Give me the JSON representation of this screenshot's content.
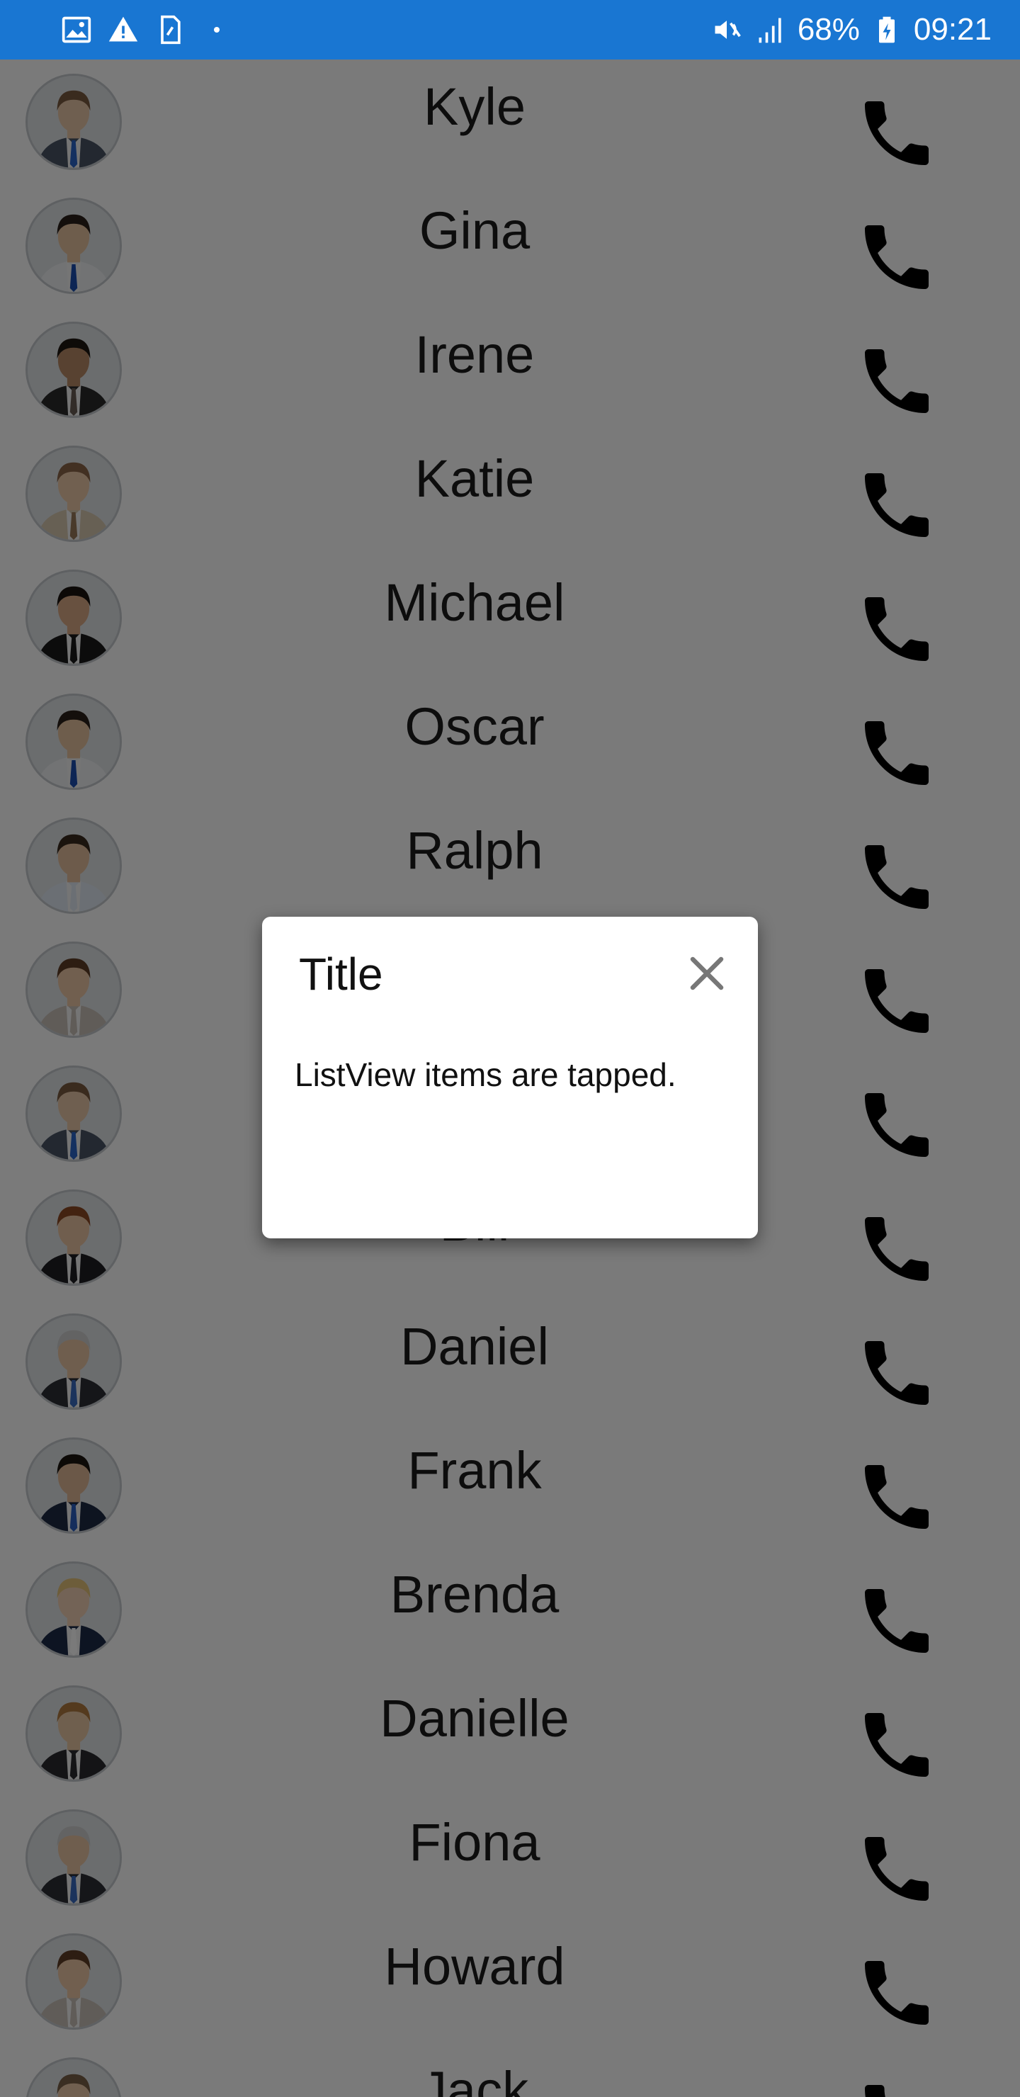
{
  "status_bar": {
    "battery": "68%",
    "time": "09:21",
    "left_icons": [
      "image-icon",
      "warning-icon",
      "sim-icon"
    ],
    "right_icons": [
      "mute-icon",
      "signal-icon",
      "battery-charging-icon"
    ]
  },
  "contacts": [
    {
      "name": "Kyle",
      "avatar": "person-male-1"
    },
    {
      "name": "Gina",
      "avatar": "person-male-2"
    },
    {
      "name": "Irene",
      "avatar": "person-male-3"
    },
    {
      "name": "Katie",
      "avatar": "person-male-4"
    },
    {
      "name": "Michael",
      "avatar": "person-male-5"
    },
    {
      "name": "Oscar",
      "avatar": "person-male-2"
    },
    {
      "name": "Ralph",
      "avatar": "person-male-6"
    },
    {
      "name": "",
      "avatar": "person-female-1"
    },
    {
      "name": "",
      "avatar": "person-male-1"
    },
    {
      "name": "Bill",
      "avatar": "person-female-2"
    },
    {
      "name": "Daniel",
      "avatar": "person-male-7"
    },
    {
      "name": "Frank",
      "avatar": "person-male-8"
    },
    {
      "name": "Brenda",
      "avatar": "person-female-3"
    },
    {
      "name": "Danielle",
      "avatar": "person-male-9"
    },
    {
      "name": "Fiona",
      "avatar": "person-male-7"
    },
    {
      "name": "Howard",
      "avatar": "person-female-1"
    },
    {
      "name": "Jack",
      "avatar": "person-female-4"
    }
  ],
  "colors": {
    "status_bar": "#1976D2",
    "overlay": "rgba(0,0,0,0.52)",
    "call_icon": "#000000"
  },
  "dialog": {
    "title": "Title",
    "message": "ListView items are tapped.",
    "close_icon": "close-icon"
  }
}
